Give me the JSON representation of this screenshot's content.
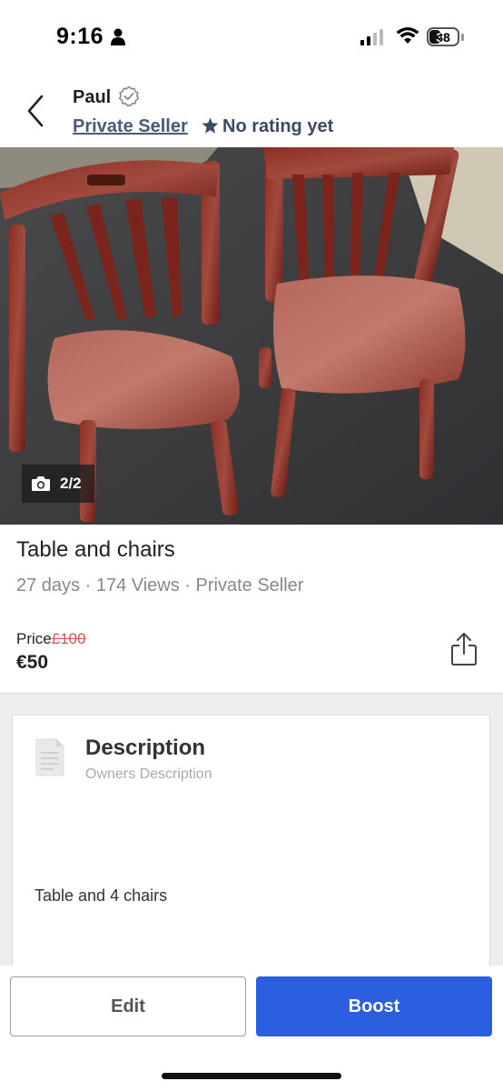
{
  "status_bar": {
    "time": "9:16",
    "battery": "38"
  },
  "header": {
    "seller_name": "Paul",
    "seller_type": "Private Seller",
    "rating": "No rating yet"
  },
  "photo": {
    "counter": "2/2"
  },
  "listing": {
    "title": "Table and chairs",
    "meta": "27 days · 174 Views · Private Seller",
    "price_label": "Price",
    "old_price": "£100",
    "price": "€50"
  },
  "description": {
    "title": "Description",
    "subtitle": "Owners Description",
    "body": "Table and 4 chairs"
  },
  "actions": {
    "edit_label": "Edit",
    "boost_label": "Boost"
  },
  "colors": {
    "primary": "#2c5ee0",
    "old_price": "#d9534f",
    "seller_link": "#4a5a78"
  },
  "icons": [
    "person-icon",
    "signal-icon",
    "wifi-icon",
    "battery-icon",
    "back-chevron-icon",
    "verified-badge-icon",
    "star-icon",
    "camera-icon",
    "share-icon",
    "document-icon"
  ]
}
